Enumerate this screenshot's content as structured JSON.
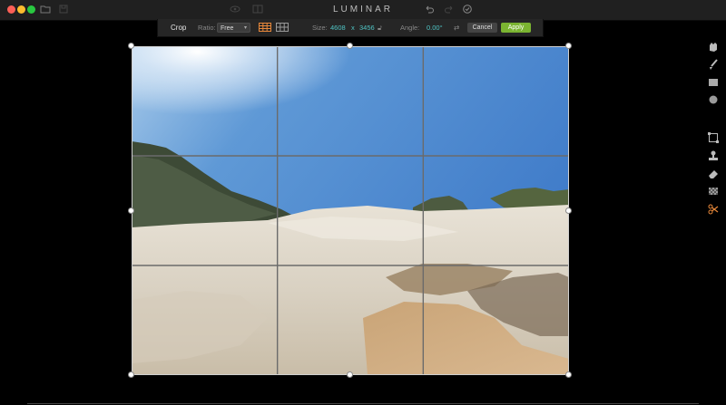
{
  "window": {
    "title": "LUMINAR"
  },
  "toolbar": {
    "crop_label": "Crop",
    "ratio_label": "Ratio:",
    "ratio_value": "Free",
    "size_label": "Size:",
    "width": "4608",
    "times": "x",
    "height": "3456",
    "angle_label": "Angle:",
    "angle_value": "0.00°",
    "cancel_label": "Cancel",
    "apply_label": "Apply"
  },
  "icons": {
    "titlebar": [
      "folder-icon",
      "save-icon",
      "eye-icon",
      "compare-icon",
      "undo-icon",
      "redo-icon",
      "history-icon"
    ],
    "sidebar": [
      "hand-icon",
      "brush-icon",
      "gradient-icon",
      "radial-icon",
      "crop-icon",
      "stamp-icon",
      "eraser-icon",
      "noise-icon",
      "scissors-icon"
    ]
  },
  "colors": {
    "accent_teal": "#4fc3c3",
    "apply_green": "#7bb431",
    "active_tool": "#e8883a"
  }
}
